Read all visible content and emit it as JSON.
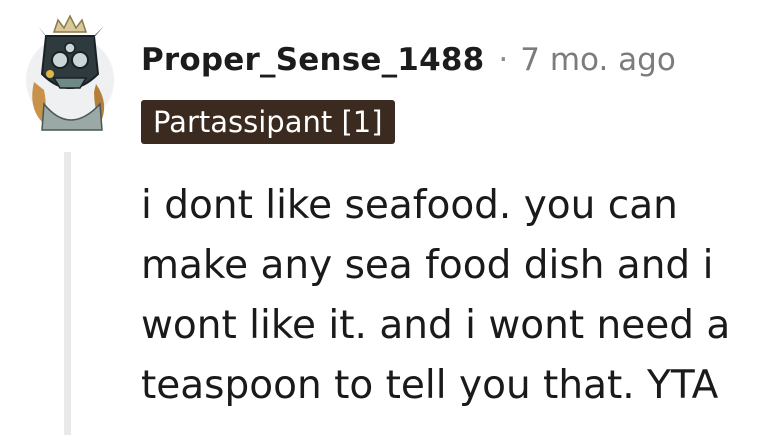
{
  "comment": {
    "author": "Proper_Sense_1488",
    "separator": "·",
    "timestamp": "7 mo. ago",
    "flair": "Partassipant [1]",
    "body_lines": [
      "i dont like seafood. you can",
      "make any sea food dish and i",
      "wont like it. and i wont need a",
      "teaspoon to tell you that. YTA"
    ]
  },
  "colors": {
    "flair_background": "#3a2a20",
    "thread_line": "#e9e9e9",
    "username": "#1c1c1c",
    "timestamp": "#7c7c7c"
  },
  "icons": {
    "avatar": "reddit-avatar-armored-character"
  }
}
